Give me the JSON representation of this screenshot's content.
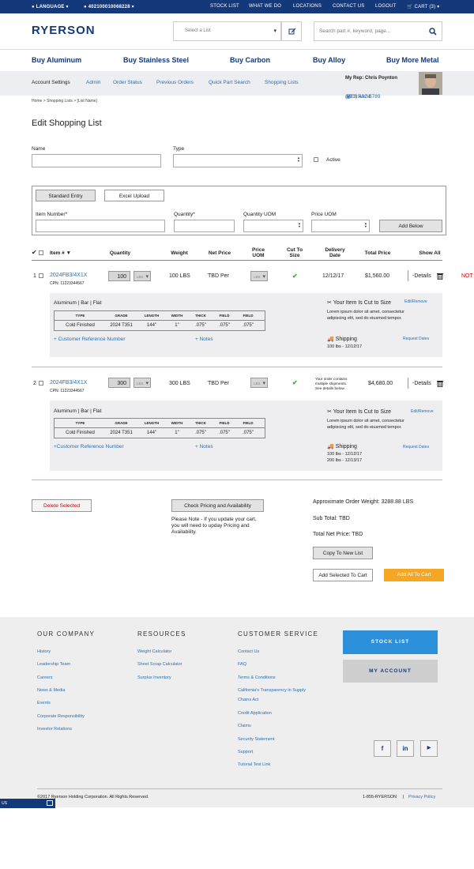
{
  "topbar": {
    "language": "LANGUAGE",
    "account": "402100010068228",
    "links": [
      "STOCK LIST",
      "WHAT WE DO",
      "LOCATIONS",
      "CONTACT US",
      "LOGOUT",
      "CART (3)"
    ]
  },
  "header": {
    "logo": "RYERSON",
    "list_select": "Select a List",
    "search_placeholder": "Search part #, keyword, page..."
  },
  "categories": [
    "Buy Aluminum",
    "Buy Stainless Steel",
    "Buy Carbon",
    "Buy Alloy",
    "Buy More Metal"
  ],
  "subnav": {
    "items": [
      "Account Settings",
      "Admin",
      "Order Status",
      "Previous Orders",
      "Quick Part Search",
      "Shopping Lists"
    ],
    "rep_label": "My Rep: Chris Poynton",
    "rep_phone": "(773) 432-6789",
    "rep_message": "MESSAGE"
  },
  "breadcrumb": "Home > Shopping Lists > [List Name]",
  "page_title": "Edit Shopping List",
  "form": {
    "name_label": "Name",
    "type_label": "Type",
    "active_label": "Active"
  },
  "entry": {
    "tab_standard": "Standard Entry",
    "tab_excel": "Excel Upload",
    "item_label": "Item Number*",
    "qty_label": "Quantity*",
    "qty_uom_label": "Quantity UOM",
    "price_uom_label": "Price UOM",
    "add_below": "Add Below"
  },
  "table_headers": {
    "item": "Item #",
    "quantity": "Quantity",
    "weight": "Weight",
    "net_price": "Net Price",
    "price_uom": "Price UOM",
    "cut": "Cut To Size",
    "delivery": "Delivery Date",
    "total": "Total Price",
    "show_all": "Show All"
  },
  "rows": [
    {
      "num": "1",
      "item": "2024FB3/4X1X",
      "cpn": "CPN: 11223344567",
      "qty": "100",
      "uom": "LBS",
      "weight": "100 LBS",
      "net": "TBD Per",
      "price_uom": "LBS",
      "delivery": "12/12/17",
      "total": "$1,560.00",
      "details": "-Details",
      "note": "NOT",
      "desc": "Aluminum | Bar | Flat",
      "spec_headers": [
        "TYPE",
        "GRADE",
        "LENGTH",
        "WIDTH",
        "THICK",
        "FIELD",
        "FIELD"
      ],
      "spec_values": [
        "Cold Finished",
        "2024 T351",
        "144\"",
        "1\"",
        ".075\"",
        ".075\"",
        ".075\""
      ],
      "cpn_link": "+ Customer Reference Number",
      "notes_link": "+ Notes",
      "cut_title": "Your Item Is Cut to Size",
      "cut_edit": "Edit/Remove",
      "cut_text1": "Lorem ipsum dolor sit amet, consectetur",
      "cut_text2": "adipiscing elit, sed do eiusmod tempor.",
      "ship_title": "Shipping",
      "ship_link": "Request Dates",
      "ship_lines": [
        "100 lbs - 12/12/17"
      ]
    },
    {
      "num": "2",
      "item": "2024FB3/4X1X",
      "cpn": "CPN: 11223344567",
      "qty": "300",
      "uom": "LBS",
      "weight": "300 LBS",
      "net": "TBD Per",
      "price_uom": "LBS",
      "delivery_lines": [
        "Your order contains",
        "multiple shipments.",
        "See details below."
      ],
      "total": "$4,680.00",
      "details": "-Details",
      "desc": "Aluminum | Bar | Flat",
      "spec_headers": [
        "TYPE",
        "GRADE",
        "LENGTH",
        "WIDTH",
        "THICK",
        "FIELD",
        "FIELD"
      ],
      "spec_values": [
        "Cold Finished",
        "2024 T351",
        "144\"",
        "1\"",
        ".075\"",
        ".075\"",
        ".075\""
      ],
      "cpn_link": "+Customer Reference Number",
      "notes_link": "+ Notes",
      "cut_title": "Your Item Is Cut to Size",
      "cut_edit": "Edit/Remove",
      "cut_text1": "Lorem ipsum dolor sit amet, consectetur",
      "cut_text2": "adipiscing elit, sed do eiusmod tempor.",
      "ship_title": "Shipping",
      "ship_link": "Request Dates",
      "ship_lines": [
        "100 lbs - 12/12/17",
        "200 lbs - 12/13/17"
      ]
    }
  ],
  "actions": {
    "delete": "Delete Selected",
    "check_pricing": "Check Pricing and Availability",
    "note1": "Please Note - If you update your cart,",
    "note2": "you will need to upday Pricing and",
    "note3": "Availability.",
    "weight": "Approximate Order Weight: 3288.88 LBS",
    "subtotal": "Sub Total: TBD",
    "total_net": "Total Net Price: TBD",
    "copy": "Copy To New List",
    "add_selected": "Add Selected To Cart",
    "add_all": "Add All To Cart"
  },
  "footer": {
    "company_title": "OUR COMPANY",
    "company": [
      "History",
      "Leadership Team",
      "Careers",
      "News & Media",
      "Events",
      "Corporate Responsibility",
      "Investor Relations"
    ],
    "resources_title": "RESOURCES",
    "resources": [
      "Weight Calculator",
      "Sheet Scrap Calculator",
      "Surplus Inventory"
    ],
    "service_title": "CUSTOMER SERVICE",
    "service": [
      "Contact Us",
      "FAQ",
      "Terms & Conditions",
      "California's Transparency in Supply",
      "Chains Act",
      "Credit Application",
      "Claims",
      "Security Statement",
      "Support",
      "Tutorial Test Link"
    ],
    "stock_list": "STOCK LIST",
    "my_account": "MY ACCOUNT",
    "copyright": "©2017 Ryerson Holding Corporation. All Rights Reserved.",
    "phone": "1-855-RYERSON",
    "privacy": "Privacy Policy",
    "chat": "US"
  },
  "colors": {
    "brand": "#14397a",
    "link": "#2a6fb5",
    "accent": "#f5a623",
    "stock_btn": "#2b8fd9",
    "delete": "#cc0000"
  }
}
